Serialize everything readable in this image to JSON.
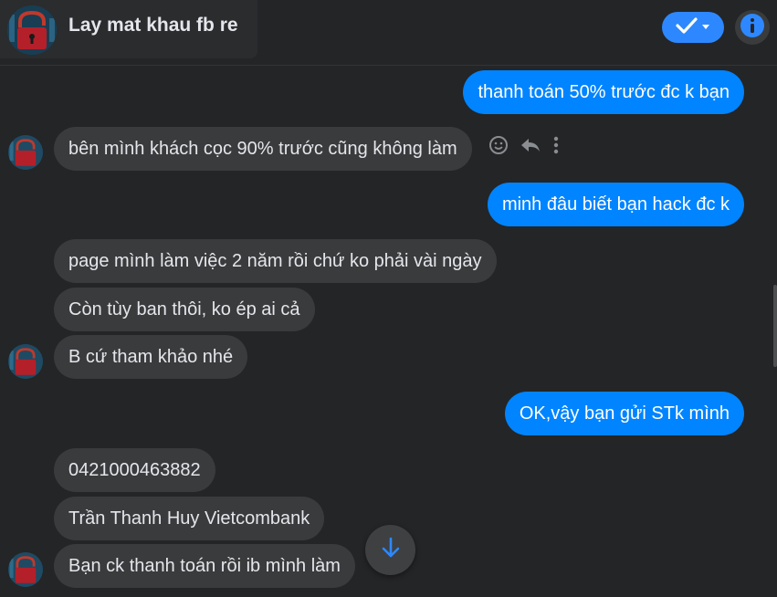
{
  "conversation": {
    "title": "Lay mat khau fb re"
  },
  "messages": [
    {
      "side": "out",
      "text": "thanh toán 50% trước đc k bạn"
    },
    {
      "side": "in",
      "text": "bên mình khách cọc 90% trước cũng không làm"
    },
    {
      "side": "out",
      "text": "minh đâu biết bạn hack đc k"
    },
    {
      "side": "in",
      "text": "page mình làm việc 2 năm rồi chứ ko phải vài ngày"
    },
    {
      "side": "in",
      "text": "Còn tùy ban thôi, ko ép ai cả"
    },
    {
      "side": "in",
      "text": "B cứ tham khảo nhé"
    },
    {
      "side": "out",
      "text": "OK,vậy bạn gửi STk mình"
    },
    {
      "side": "in",
      "text": "0421000463882"
    },
    {
      "side": "in",
      "text": "Trần Thanh Huy Vietcombank"
    },
    {
      "side": "in",
      "text": "Bạn ck thanh toán rồi ib mình làm"
    }
  ],
  "icons": {
    "header_avatar": "hacker-lock-avatar",
    "status": "check-icon",
    "info": "info-icon",
    "react": "smiley-icon",
    "reply": "reply-icon",
    "more": "more-vertical-icon",
    "scroll_down": "arrow-down-icon"
  },
  "colors": {
    "background": "#242526",
    "incoming_bubble": "#3a3b3c",
    "outgoing_bubble": "#0084ff",
    "accent": "#2d88ff"
  }
}
